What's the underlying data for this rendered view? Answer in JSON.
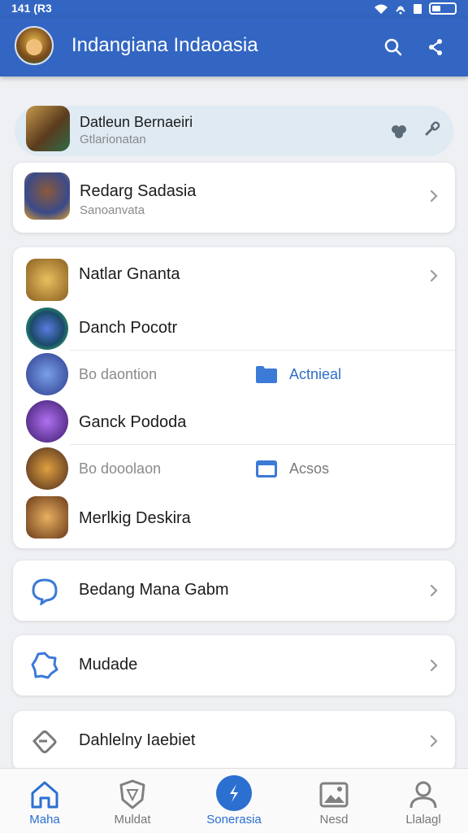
{
  "status": {
    "time": "141 (R3"
  },
  "appbar": {
    "title": "Indangiana Indaoasia"
  },
  "featured": {
    "title": "Datleun Bernaeiri",
    "subtitle": "Gtlarionatan"
  },
  "card1": {
    "title": "Redarg Sadasia",
    "subtitle": "Sanoanvata"
  },
  "list": {
    "item1": "Natlar Gnanta",
    "item2": "Danch Pocotr",
    "item3": {
      "label": "Bo daontion",
      "action": "Actnieal"
    },
    "item4": "Ganck Pododa",
    "item5": {
      "label": "Bo dooolaon",
      "action": "Acsos"
    },
    "item6": "Merlkig Deskira"
  },
  "menu": {
    "item1": "Bedang Mana Gabm",
    "item2": "Mudade",
    "item3": "Dahlelny Iaebiet"
  },
  "tabs": [
    {
      "label": "Maha",
      "icon": "home-icon"
    },
    {
      "label": "Muldat",
      "icon": "shield-icon"
    },
    {
      "label": "Sonerasia",
      "icon": "lightning-icon"
    },
    {
      "label": "Nesd",
      "icon": "image-icon"
    },
    {
      "label": "Llalagl",
      "icon": "person-icon"
    }
  ],
  "colors": {
    "primary": "#3366c2",
    "accent": "#2f6ec8",
    "active_tab": "#2b6fd1",
    "featured_bg": "#dfeaf3"
  }
}
